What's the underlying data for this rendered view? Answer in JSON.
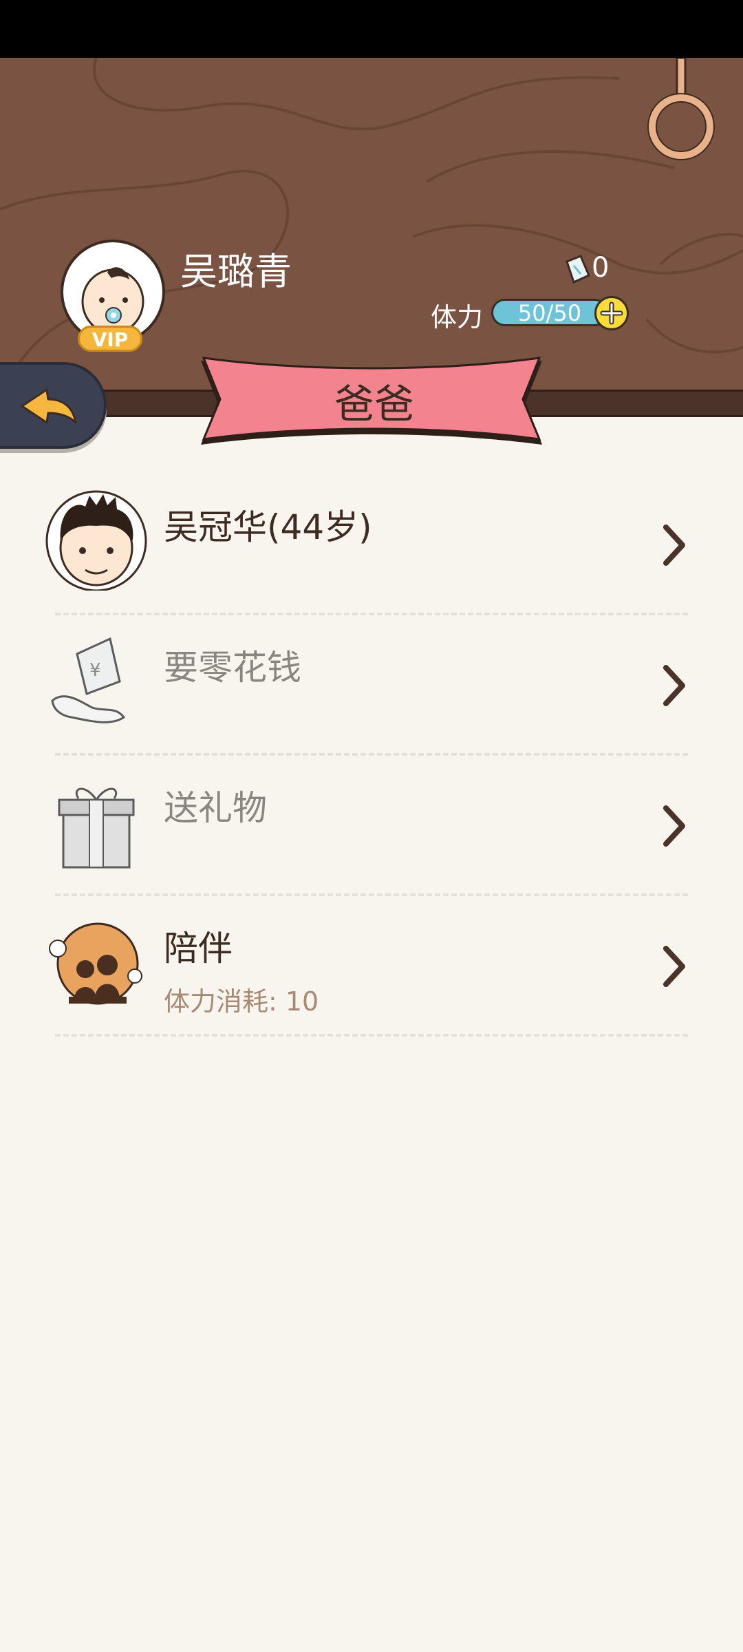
{
  "header": {
    "user_name": "吴璐青",
    "vip_label": "VIP",
    "gem_count": "0",
    "stamina_label": "体力",
    "stamina_value": "50/50",
    "stamina_fraction": 1.0
  },
  "banner": {
    "title": "爸爸"
  },
  "list": {
    "items": [
      {
        "title": "吴冠华(44岁)",
        "subtitle": "",
        "icon": "father-face-icon"
      },
      {
        "title": "要零花钱",
        "subtitle": "",
        "icon": "pocket-money-icon"
      },
      {
        "title": "送礼物",
        "subtitle": "",
        "icon": "gift-icon"
      },
      {
        "title": "陪伴",
        "subtitle": "体力消耗: 10",
        "icon": "companion-icon"
      }
    ]
  },
  "colors": {
    "wood": "#7a5343",
    "ribbon": "#f3838e",
    "stamina_bar": "#6ec3d8",
    "vip": "#f4b73b",
    "back_arrow": "#f6b740"
  }
}
